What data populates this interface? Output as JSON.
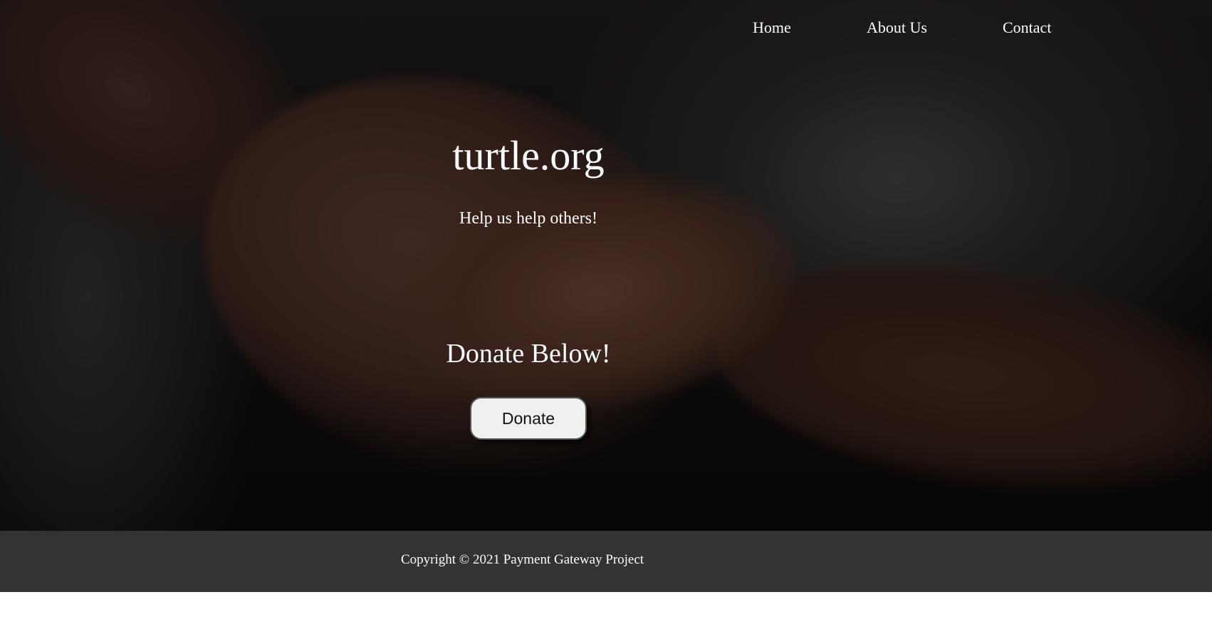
{
  "nav": {
    "items": [
      {
        "label": "Home"
      },
      {
        "label": "About Us"
      },
      {
        "label": "Contact"
      }
    ]
  },
  "hero": {
    "title": "turtle.org",
    "tagline": "Help us help others!",
    "donate_heading": "Donate Below!",
    "donate_button": "Donate"
  },
  "footer": {
    "copyright": "Copyright © 2021 Payment Gateway Project"
  },
  "colors": {
    "text": "#ffffff",
    "footer_bg": "#333333",
    "button_bg": "#f0f0f0",
    "page_bg": "#ffffff"
  }
}
